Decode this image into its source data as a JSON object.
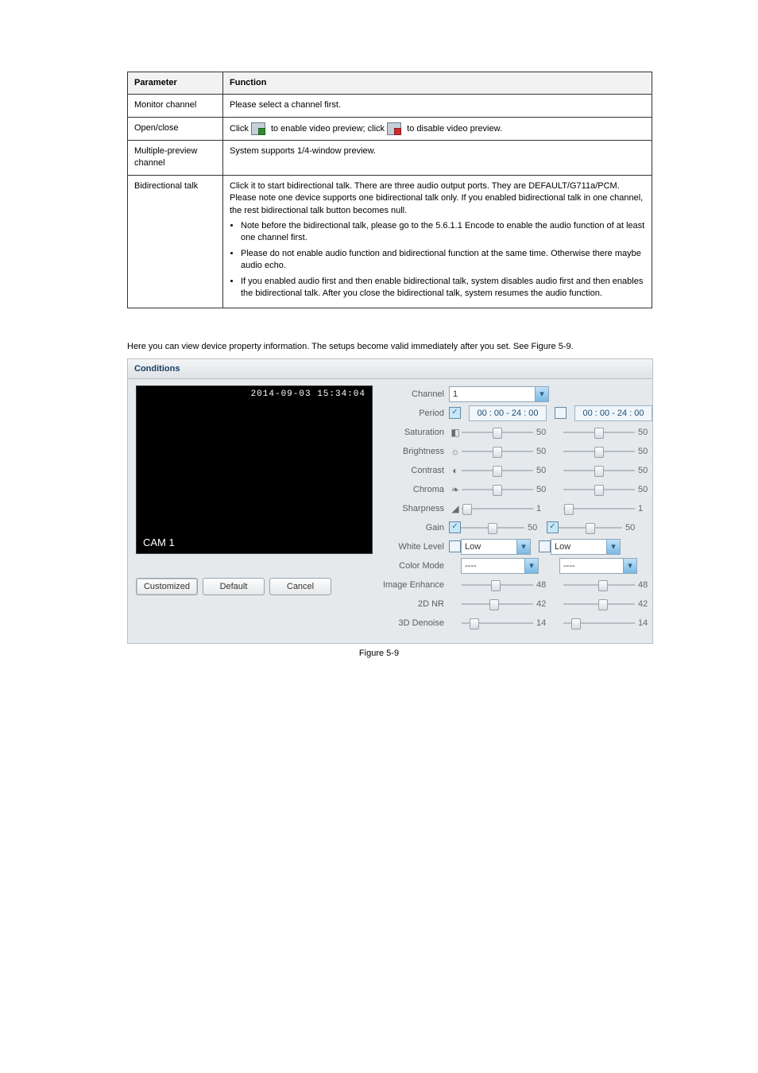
{
  "table": {
    "header": {
      "c1": "Parameter",
      "c2": "Function"
    },
    "rows": [
      {
        "c1": "Monitor channel",
        "c2": "Please select a channel first."
      },
      {
        "c1": "Open/close",
        "c2_pre": "Click ",
        "c2_mid": " to enable video preview; click ",
        "c2_post": " to disable video preview.",
        "icon1": "preview-enable-icon",
        "icon2": "preview-disable-icon"
      },
      {
        "c1": "Multiple-preview channel",
        "c2": "System supports 1/4-window preview."
      },
      {
        "c1": "Bidirectional talk",
        "c2_intro": "Click it to start bidirectional talk. There are three audio output ports. They are DEFAULT/G711a/PCM. Please note one device supports one bidirectional talk only. If you enabled bidirectional talk in one channel, the rest bidirectional talk button becomes null.",
        "bullets": [
          "Note before the bidirectional talk, please go to the 5.6.1.1 Encode to enable the audio function of at least one channel first.",
          "Please do not enable audio function and bidirectional function at the same time. Otherwise there maybe audio echo.",
          "If you enabled audio first and then enable bidirectional talk, system disables audio first and then enables the bidirectional talk. After you close the bidirectional talk, system resumes the audio function."
        ]
      }
    ]
  },
  "para": "Here you can view device property information. The setups become valid immediately after you set. See Figure 5-9.",
  "figure_caption": "Figure 5-9",
  "window": {
    "title": "Conditions",
    "preview_time": "2014-09-03 15:34:04",
    "cam_label": "CAM 1",
    "buttons": {
      "customized": "Customized",
      "default": "Default",
      "cancel": "Cancel"
    },
    "channel_label": "Channel",
    "channel_value": "1",
    "rows": {
      "period": {
        "label": "Period",
        "chk1": true,
        "time1": "00 : 00 - 24 : 00",
        "chk2": false,
        "time2": "00 : 00 - 24 : 00"
      },
      "saturation": {
        "label": "Saturation",
        "glyph": "◧",
        "v1": 50,
        "p1": 50,
        "v2": 50,
        "p2": 50
      },
      "brightness": {
        "label": "Brightness",
        "glyph": "☼",
        "v1": 50,
        "p1": 50,
        "v2": 50,
        "p2": 50
      },
      "contrast": {
        "label": "Contrast",
        "glyph": "◐",
        "v1": 50,
        "p1": 50,
        "v2": 50,
        "p2": 50
      },
      "chroma": {
        "label": "Chroma",
        "glyph": "❧",
        "v1": 50,
        "p1": 50,
        "v2": 50,
        "p2": 50
      },
      "sharpness": {
        "label": "Sharpness",
        "glyph": "◢",
        "v1": 1,
        "p1": 8,
        "v2": 1,
        "p2": 8
      },
      "gain": {
        "label": "Gain",
        "chk1": true,
        "v1": 50,
        "p1": 50,
        "chk2": true,
        "v2": 50,
        "p2": 50
      },
      "white": {
        "label": "White Level",
        "chk1": false,
        "sel1": "Low",
        "chk2": false,
        "sel2": "Low"
      },
      "colormode": {
        "label": "Color Mode",
        "sel1": "----",
        "sel2": "----"
      },
      "enhance": {
        "label": "Image Enhance",
        "v1": 48,
        "p1": 48,
        "v2": 48,
        "p2": 55
      },
      "nr2d": {
        "label": "2D NR",
        "v1": 42,
        "p1": 46,
        "v2": 42,
        "p2": 55
      },
      "nr3d": {
        "label": "3D Denoise",
        "v1": 14,
        "p1": 18,
        "v2": 14,
        "p2": 18
      }
    }
  }
}
